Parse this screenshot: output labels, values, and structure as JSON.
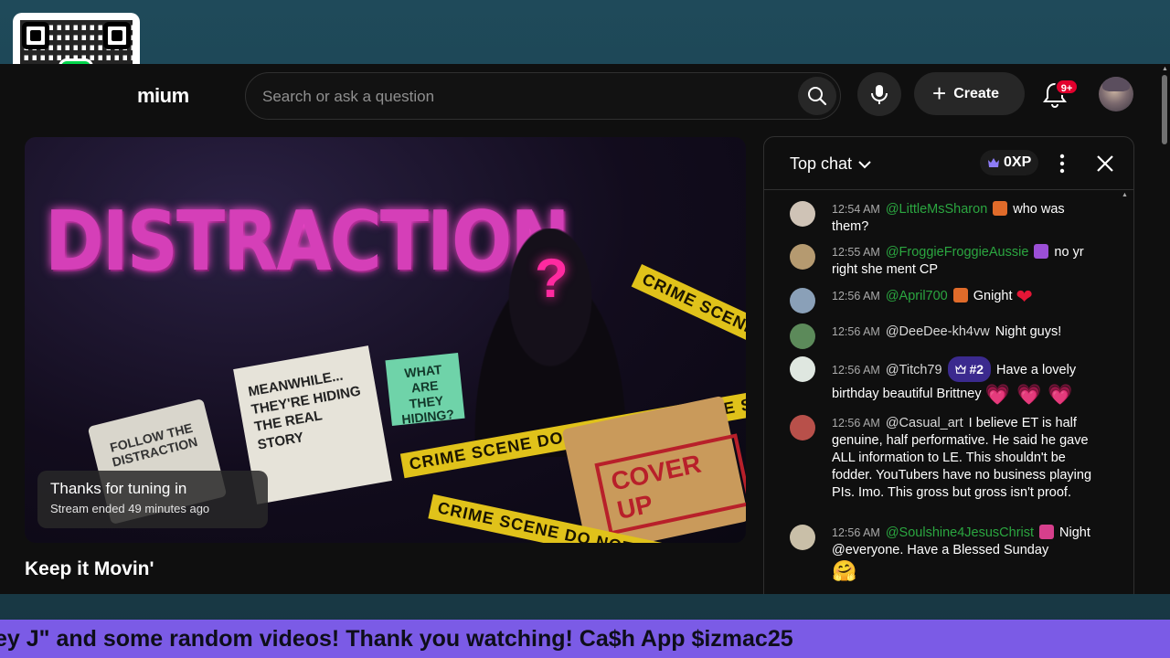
{
  "header": {
    "logo_text": "mium",
    "search_placeholder": "Search or ask a question",
    "create_label": "Create",
    "notification_count": "9+"
  },
  "video": {
    "thumbnail_texts": {
      "title": "DISTRACTION",
      "note": "MEANWHILE... THEY'RE HIDING THE REAL STORY",
      "sticky": "WHAT ARE THEY HIDING?",
      "follow": "FOLLOW THE DISTRACTION",
      "stamp": "COVER UP",
      "tape1": "CRIME SCENE DO NOT CROSS CRIME SCENE DO NOT CROSS",
      "tape2": "CRIME SCENE DO NOT CROSS",
      "tape3": "CRIME SCENE",
      "question": "?"
    },
    "ended_line1": "Thanks for tuning in",
    "ended_line2": "Stream ended 49 minutes ago",
    "title": "Keep it Movin'"
  },
  "chat": {
    "mode_label": "Top chat",
    "xp_label": "0XP",
    "messages": [
      {
        "time": "12:54 AM",
        "author": "@LittleMsSharon",
        "text": "who was them?",
        "avatar_color": "#cfc3b6"
      },
      {
        "time": "12:55 AM",
        "author": "@FroggieFroggieAussie",
        "text": "no yr right she ment CP",
        "avatar_color": "#b59a70"
      },
      {
        "time": "12:56 AM",
        "author": "@April700",
        "text": "Gnight",
        "emoji": "❤",
        "avatar_color": "#8aa0b8"
      },
      {
        "time": "12:56 AM",
        "author": "@DeeDee-kh4vw",
        "text": "Night guys!",
        "avatar_color": "#5c8a5a"
      },
      {
        "time": "12:56 AM",
        "author": "@Titch79",
        "rank": "#2",
        "text": "Have a lovely birthday beautiful Brittney",
        "emoji": "💗 💗 💗",
        "avatar_color": "#dfe7e0"
      },
      {
        "time": "12:56 AM",
        "author": "@Casual_art",
        "text": "I believe ET is half genuine, half performative. He said he gave ALL information to LE. This shouldn't be fodder. YouTubers have no business playing PIs. Imo. This gross but gross isn't proof.",
        "avatar_color": "#b8504a"
      },
      {
        "time": "12:56 AM",
        "author": "@Soulshine4JesusChrist",
        "text": "Night @everyone. Have a Blessed Sunday",
        "emoji": "🤗",
        "avatar_color": "#c9bfa8"
      }
    ]
  },
  "ticker": {
    "text": "ey J\" and some random videos! Thank you watching! Ca$h App $izmac25"
  },
  "colors": {
    "background": "#0f0f0f",
    "accent_ticker": "#7b5be6",
    "author_green": "#2ba640",
    "badge_red": "#e2002d",
    "cash_green": "#00d54b"
  },
  "icons": [
    "search-icon",
    "mic-icon",
    "plus-icon",
    "bell-icon",
    "chevron-down-icon",
    "crown-icon",
    "more-vert-icon",
    "close-icon",
    "cash-app-icon"
  ]
}
